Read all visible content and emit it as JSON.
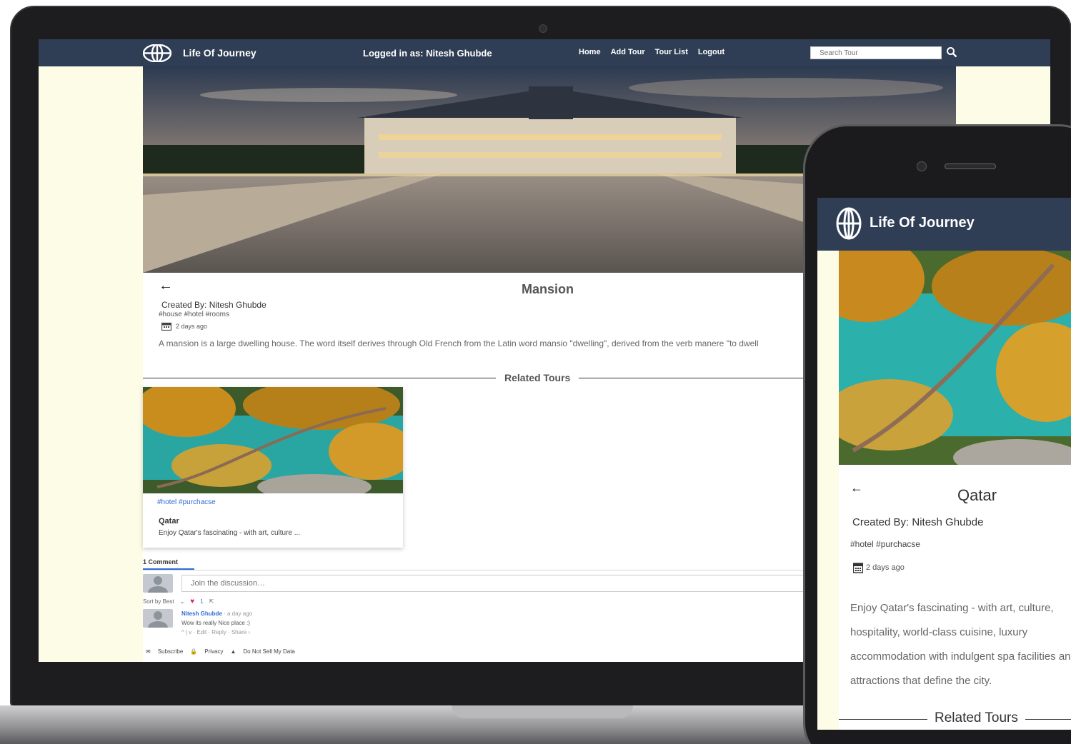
{
  "brand": "Life Of Journey",
  "desktop": {
    "nav": {
      "logged_in": "Logged in as: Nitesh Ghubde",
      "links": [
        "Home",
        "Add Tour",
        "Tour List",
        "Logout"
      ],
      "search_placeholder": "Search Tour"
    },
    "tour": {
      "back": "←",
      "title": "Mansion",
      "created_by": "Created By: Nitesh Ghubde",
      "tags": "#house #hotel #rooms",
      "date": "2 days ago",
      "description": "A mansion is a large dwelling house. The word itself derives through Old French from the Latin word mansio \"dwelling\", derived from the verb manere \"to dwell"
    },
    "related": {
      "heading": "Related Tours",
      "card": {
        "tags": "#hotel #purchacse",
        "title": "Qatar",
        "text": "Enjoy Qatar's fascinating - with art, culture ..."
      }
    },
    "comments": {
      "count": "1 Comment",
      "placeholder": "Join the discussion…",
      "sort": "Sort by Best",
      "like_count": "1",
      "author": "Nitesh Ghubde",
      "time": "· a day ago",
      "text": "Wow its really Nice place :)",
      "actions": "^ | v · Edit · Reply · Share ›",
      "footer": [
        "Subscribe",
        "Privacy",
        "Do Not Sell My Data"
      ]
    }
  },
  "mobile": {
    "back": "←",
    "title": "Qatar",
    "created_by": "Created By: Nitesh Ghubde",
    "tags": "#hotel #purchacse",
    "date": "2 days ago",
    "description": "Enjoy Qatar's fascinating - with art, culture, hospitality, world-class cuisine, luxury accommodation with indulgent spa facilities and attractions that define the city.",
    "related_heading": "Related Tours"
  },
  "colors": {
    "navbar": "#2f3e55",
    "page_bg": "#fdfce6",
    "link_blue": "#2f6bd4"
  }
}
